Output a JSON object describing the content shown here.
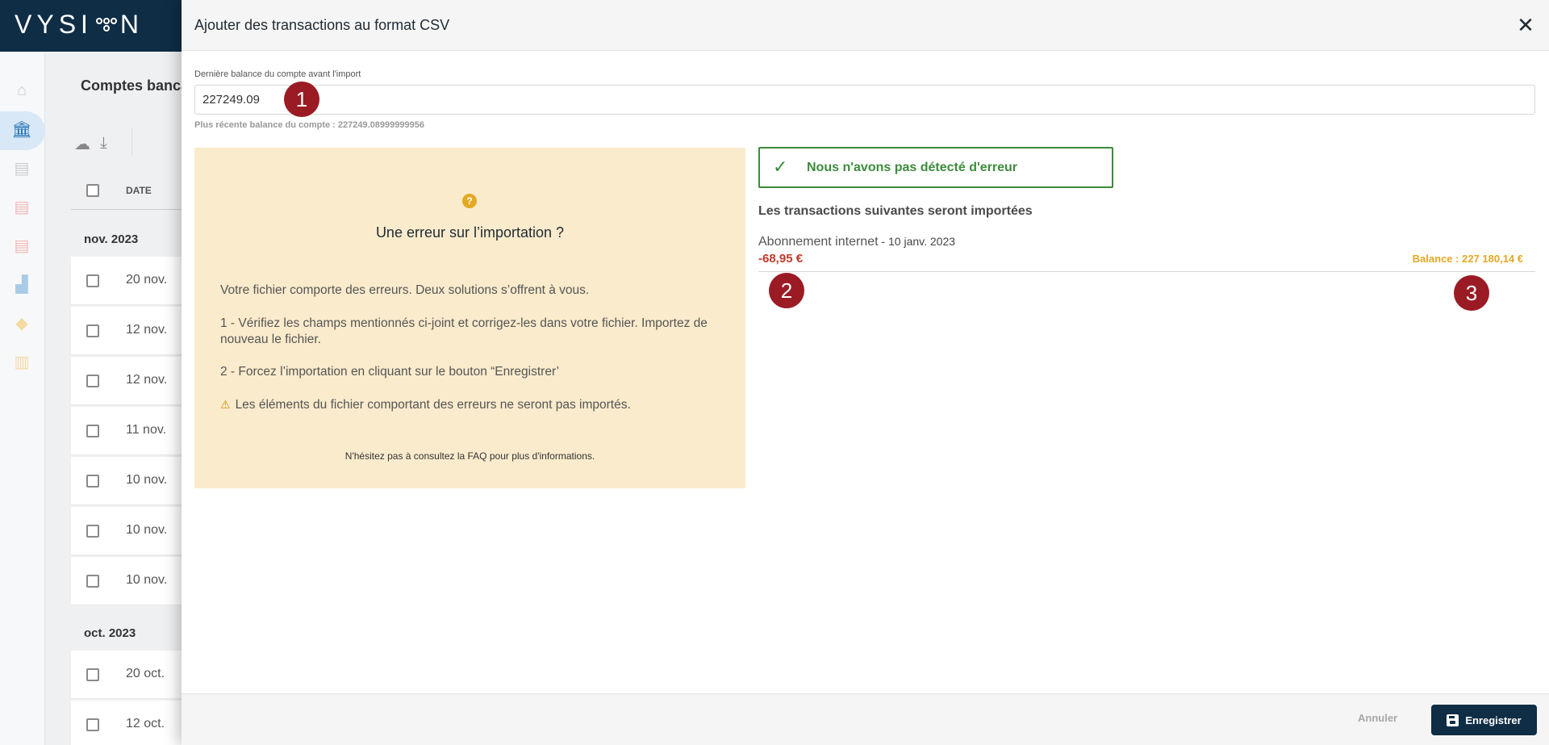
{
  "app": {
    "logo_text_left": "VYSI",
    "logo_text_right": "N",
    "page_title": "Comptes banca",
    "list_header_date": "DATE",
    "groups": [
      {
        "month": "nov. 2023",
        "rows": [
          "20 nov.",
          "12 nov.",
          "12 nov.",
          "11 nov.",
          "10 nov.",
          "10 nov.",
          "10 nov."
        ]
      },
      {
        "month": "oct. 2023",
        "rows": [
          "20 oct.",
          "12 oct."
        ]
      }
    ]
  },
  "modal": {
    "title": "Ajouter des transactions au format CSV",
    "close_icon": "close-icon",
    "balance_label": "Dernière balance du compte avant l'import",
    "balance_value": "227249.09",
    "balance_hint": "Plus récente balance du compte : 227249.08999999956",
    "help": {
      "icon": "?",
      "title": "Une erreur sur l’importation ?",
      "p1": "Votre fichier comporte des erreurs. Deux solutions s’offrent à vous.",
      "p2": "1 - Vérifiez les champs mentionnés ci-joint et corrigez-les dans votre fichier. Importez de nouveau le fichier.",
      "p3": "2 - Forcez l’importation en cliquant sur le bouton “Enregistrer’",
      "p4": "Les éléments du fichier comportant des erreurs ne seront pas importés.",
      "footer": "N'hésitez pas à consultez la FAQ pour plus d'informations."
    },
    "status": {
      "text": "Nous n'avons pas détecté d'erreur",
      "color": "#3c8c3c"
    },
    "transactions_heading": "Les transactions suivantes seront importées",
    "transaction": {
      "name": "Abonnement internet",
      "separator": " - ",
      "date": "10 janv. 2023",
      "amount": "-68,95 €",
      "balance": "Balance : 227 180,14 €"
    },
    "markers": [
      "1",
      "2",
      "3"
    ],
    "footer": {
      "cancel_label": "Annuler",
      "save_label": "Enregistrer"
    }
  },
  "colors": {
    "brand_dark": "#0f2d45",
    "marker_red": "#9b1b24",
    "amount_red": "#c0392b",
    "balance_orange": "#e5a823",
    "help_bg": "#faebcc"
  }
}
